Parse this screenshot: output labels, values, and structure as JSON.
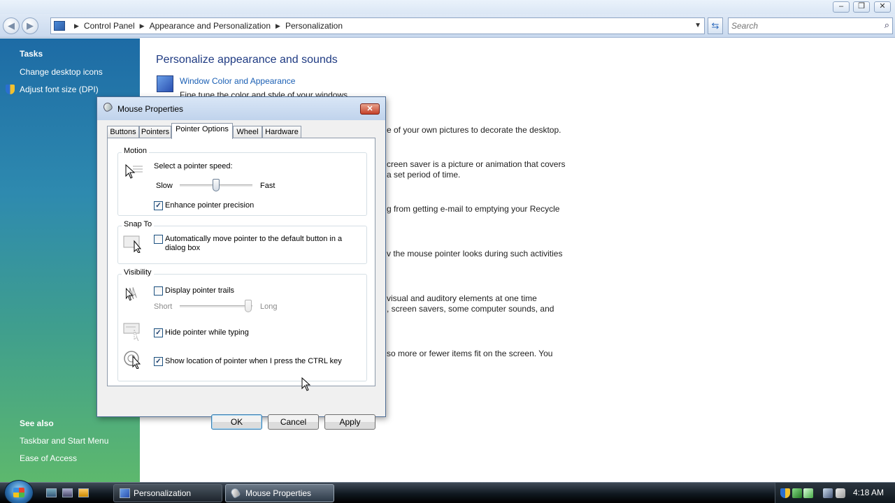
{
  "explorer": {
    "breadcrumb": [
      "Control Panel",
      "Appearance and Personalization",
      "Personalization"
    ],
    "search_placeholder": "Search",
    "left_pane": {
      "tasks_heading": "Tasks",
      "task_links": [
        "Change desktop icons",
        "Adjust font size (DPI)"
      ],
      "see_also_heading": "See also",
      "see_also_links": [
        "Taskbar and Start Menu",
        "Ease of Access"
      ]
    },
    "main": {
      "title": "Personalize appearance and sounds",
      "first_item_link": "Window Color and Appearance",
      "first_item_desc": "Fine tune the color and style of your windows.",
      "background_fragments": [
        "e of your own pictures to decorate the desktop.",
        "creen saver is a picture or animation that covers",
        "a set period of time.",
        "g from getting e-mail to emptying your Recycle",
        "v the mouse pointer looks during such activities",
        "visual and auditory elements at one time",
        ", screen savers, some computer sounds, and",
        "so more or fewer items fit on the screen. You"
      ]
    }
  },
  "dialog": {
    "title": "Mouse Properties",
    "close_glyph": "✕",
    "tabs": [
      "Buttons",
      "Pointers",
      "Pointer Options",
      "Wheel",
      "Hardware"
    ],
    "active_tab": "Pointer Options",
    "motion": {
      "label": "Motion",
      "speed_label": "Select a pointer speed:",
      "slow": "Slow",
      "fast": "Fast",
      "speed_value": 0.5,
      "precision_label": "Enhance pointer precision",
      "precision_checked": true
    },
    "snap_to": {
      "label": "Snap To",
      "auto_label": "Automatically move pointer to the default button in a dialog box",
      "auto_checked": false
    },
    "visibility": {
      "label": "Visibility",
      "trails_label": "Display pointer trails",
      "trails_checked": false,
      "short": "Short",
      "long": "Long",
      "trails_value": 0.95,
      "hide_label": "Hide pointer while typing",
      "hide_checked": true,
      "ctrl_label": "Show location of pointer when I press the CTRL key",
      "ctrl_checked": true
    },
    "buttons": {
      "ok": "OK",
      "cancel": "Cancel",
      "apply": "Apply"
    }
  },
  "taskbar": {
    "tasks": [
      "Personalization",
      "Mouse Properties"
    ],
    "clock": "4:18 AM"
  }
}
